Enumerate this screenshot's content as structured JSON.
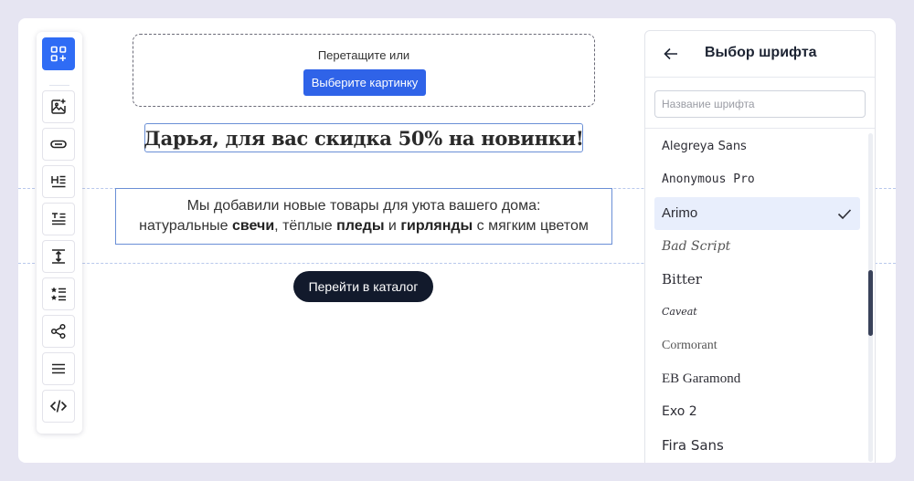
{
  "toolbar": {
    "tools": [
      {
        "icon": "add-block-icon",
        "active": true
      },
      {
        "icon": "add-image-icon",
        "active": false
      },
      {
        "icon": "button-icon",
        "active": false
      },
      {
        "icon": "heading-icon",
        "active": false
      },
      {
        "icon": "text-icon",
        "active": false
      },
      {
        "icon": "spacer-icon",
        "active": false
      },
      {
        "icon": "list-icon",
        "active": false
      },
      {
        "icon": "social-icon",
        "active": false
      },
      {
        "icon": "divider-icon",
        "active": false
      },
      {
        "icon": "html-code-icon",
        "active": false
      }
    ]
  },
  "canvas": {
    "upload": {
      "prompt": "Перетащите или",
      "button_label": "Выберите картинку"
    },
    "heading": "Дарья, для вас скидка 50% на новинки!",
    "text_block": {
      "line1": "Мы добавили новые товары для уюта вашего дома:",
      "line2_parts": [
        "натуральные ",
        "свечи",
        ", тёплые ",
        "пледы",
        " и ",
        "гирлянды",
        " с мягким цветом"
      ]
    },
    "cta_label": "Перейти в каталог"
  },
  "font_panel": {
    "title": "Выбор шрифта",
    "search_placeholder": "Название шрифта",
    "selected_font": "Arimo",
    "fonts": [
      "Alegreya Sans",
      "Anonymous Pro",
      "Arimo",
      "Bad Script",
      "Bitter",
      "Caveat",
      "Cormorant",
      "EB Garamond",
      "Exo 2",
      "Fira Sans"
    ]
  },
  "colors": {
    "accent": "#2f6cf5",
    "upload_button": "#2f63e8",
    "cta_background": "#121a2c",
    "selected_row": "#e8eefc",
    "page_background": "#e6e5f2"
  }
}
